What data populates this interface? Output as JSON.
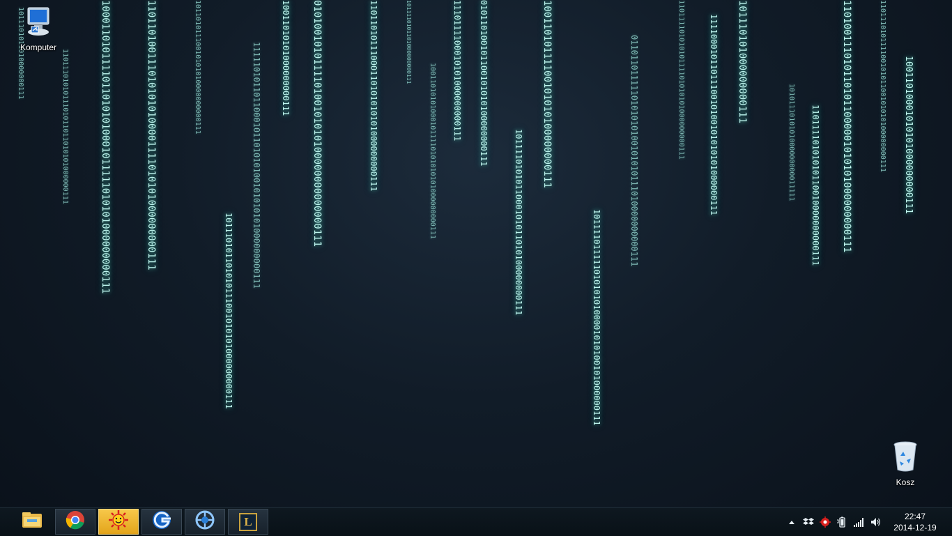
{
  "desktop": {
    "icons": [
      {
        "label": "Komputer",
        "icon": "computer-icon"
      },
      {
        "label": "Kosz",
        "icon": "recycle-bin-icon"
      }
    ],
    "binary_columns": [
      "1011101011010000000111",
      "1101110101011101011011010101000000111",
      "10001101011110110101010001011111010101000000000111",
      "1101101001110101010100001111010101000000000111",
      "10110101110010101010000000000111",
      "10011010101000000000111",
      "1111101011011000101101010100101010101000000000111",
      "101110101101010111001010101000000000111",
      "010100101011110100101010100000000000000111",
      "11011010111000110101010101000000000111",
      "100110101010001011110101010101000000000111",
      "1110111100010101000000000111",
      "010110100101100101010100000000111",
      "1011110101011000101011010100000000111",
      "10011010111100101010100000000111",
      "1011110111110101010100001010100101000000111",
      "0110110111110101010100101010111010000000000111",
      "11011110101010111101010101000000000111",
      "1111000101101110010100101010101000000111",
      "101110101000000000111",
      "1010111010101000000000011111",
      "11011110101010110010000000000111",
      "1101001110101101011000001010101000000000111",
      "11011101011110010101100101010100000000111",
      "10011010001010101000000000111",
      "1011110101101000000000111"
    ]
  },
  "taskbar": {
    "pinned": [
      {
        "name": "file-explorer",
        "icon": "folder-icon"
      },
      {
        "name": "chrome",
        "icon": "chrome-icon"
      },
      {
        "name": "sun-app",
        "icon": "sun-face-icon"
      },
      {
        "name": "g-app",
        "icon": "blue-g-icon"
      },
      {
        "name": "wheel-app",
        "icon": "blue-wheel-icon"
      },
      {
        "name": "league-of-legends",
        "icon": "lol-icon",
        "letter": "L"
      }
    ]
  },
  "tray": {
    "icons": [
      "show-hidden-arrow-icon",
      "dropbox-icon",
      "antivirus-icon",
      "battery-icon",
      "network-signal-icon",
      "volume-icon"
    ],
    "time": "22:47",
    "date": "2014-12-19"
  },
  "colors": {
    "binary_glow": "#bff6ef",
    "taskbar": "#0c151d",
    "active_button": "#f0b838"
  }
}
